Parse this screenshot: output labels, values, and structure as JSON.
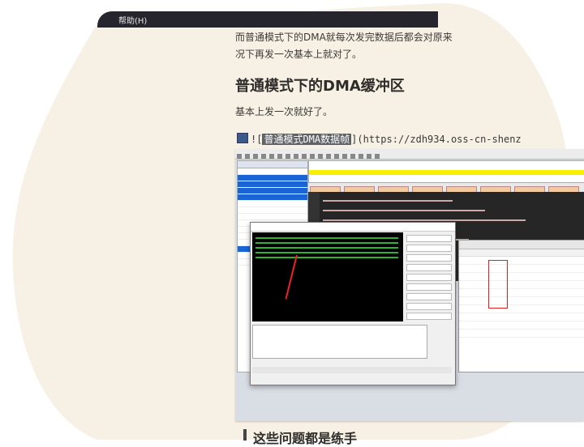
{
  "menu": {
    "help_label": "帮助(H)"
  },
  "article": {
    "para1_line1": "而普通模式下的DMA就每次发完数据后都会对原来",
    "para1_line2": "况下再发一次基本上就对了。",
    "heading": "普通模式下的DMA缓冲区",
    "para2": "基本上发一次就好了。",
    "md_prefix": "![",
    "md_alt": "普通模式DMA数据帧",
    "md_suffix": "](https://zdh934.oss-cn-shenz",
    "next_heading": "这些问题都是练手"
  },
  "colors": {
    "accent_yellow": "#f8f000",
    "highlight_blue": "#1b64d6",
    "terminal_green": "#3de03d",
    "annotation_red": "#e0201c"
  }
}
